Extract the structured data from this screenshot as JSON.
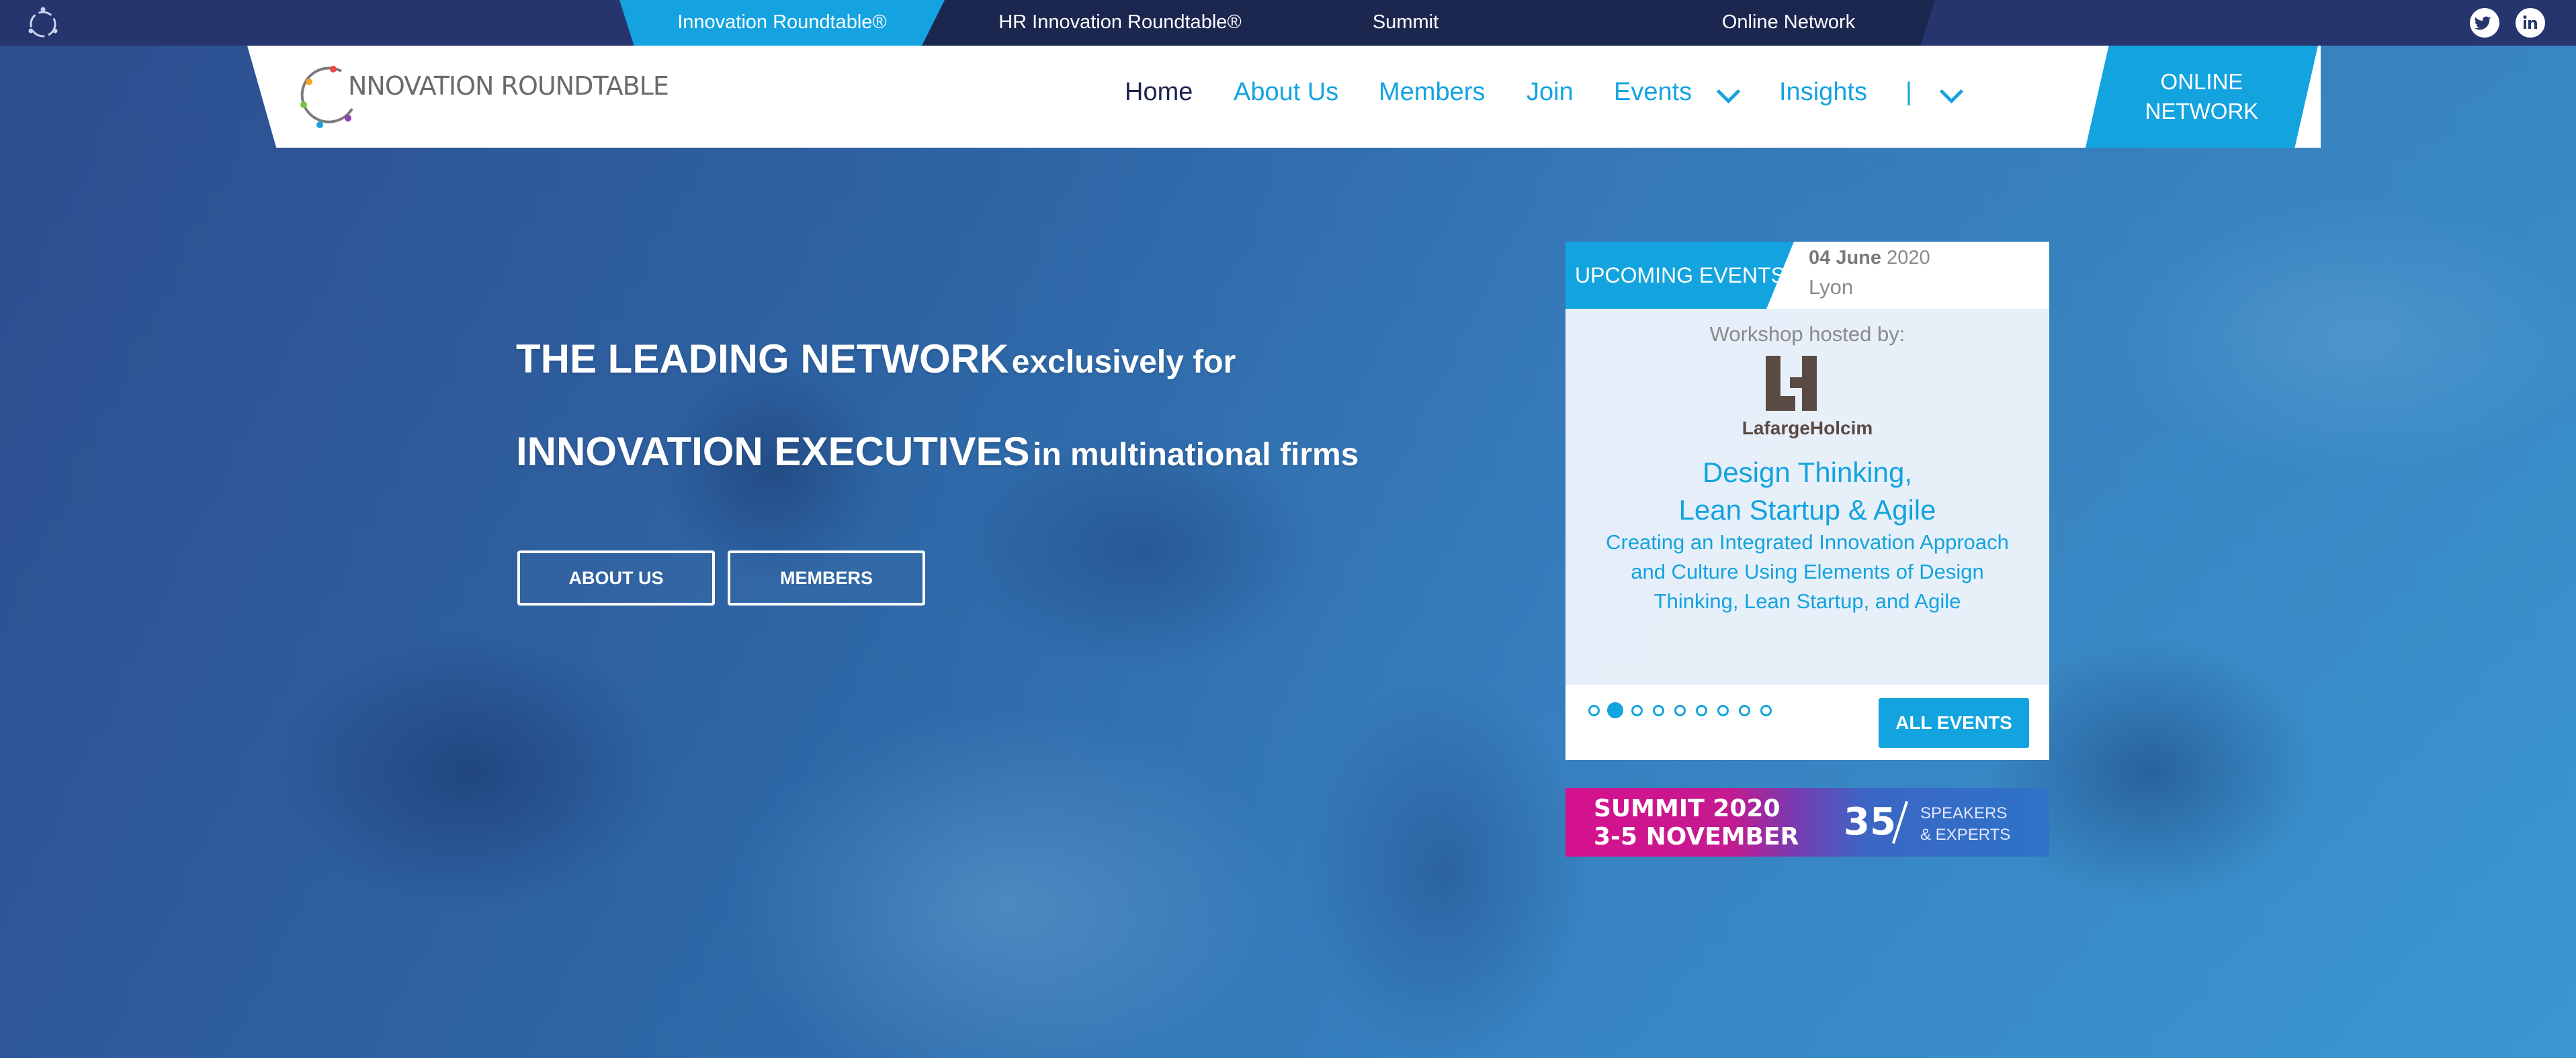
{
  "topbar": {
    "tabs": [
      {
        "label": "Innovation Roundtable®",
        "active": true
      },
      {
        "label": "HR Innovation Roundtable®",
        "active": false
      },
      {
        "label": "Summit",
        "active": false
      },
      {
        "label": "Online Network",
        "active": false
      }
    ],
    "social": [
      "twitter-icon",
      "linkedin-icon"
    ]
  },
  "brand": {
    "name": "NNOVATION ROUNDTABLE"
  },
  "nav": {
    "items": [
      "Home",
      "About Us",
      "Members",
      "Join",
      "Events",
      "Insights",
      "|"
    ],
    "current": "Home",
    "online_line1": "ONLINE",
    "online_line2": "NETWORK"
  },
  "hero": {
    "line1_big": "THE LEADING NETWORK",
    "line1_small": "exclusively for",
    "line2_big": "INNOVATION EXECUTIVES",
    "line2_small": "in multinational firms",
    "btn_about": "ABOUT US",
    "btn_members": "MEMBERS"
  },
  "events": {
    "header": "UPCOMING EVENTS",
    "date_day": "04 June",
    "date_year": "2020",
    "city": "Lyon",
    "hosted_by": "Workshop hosted by:",
    "host_name": "LafargeHolcim",
    "title_line1": "Design Thinking,",
    "title_line2": "Lean Startup & Agile",
    "description": "Creating an Integrated Innovation Approach and Culture Using Elements of Design Thinking, Lean Startup, and Agile",
    "slides": 9,
    "active_slide": 2,
    "all_events": "ALL EVENTS"
  },
  "summit": {
    "line1": "SUMMIT 2020",
    "line2": "3-5 NOVEMBER",
    "count": "35",
    "label1": "SPEAKERS",
    "label2": "& EXPERTS"
  },
  "colors": {
    "accent": "#13a3df",
    "topbar": "#27356e",
    "topbar_tabs": "#1c2750",
    "summit_pink": "#d6118e"
  }
}
